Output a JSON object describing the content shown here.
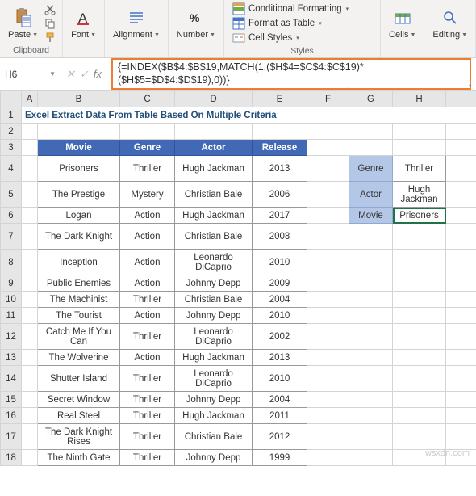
{
  "ribbon": {
    "clipboard": {
      "paste": "Paste",
      "label": "Clipboard"
    },
    "font": {
      "btn": "Font"
    },
    "alignment": {
      "btn": "Alignment"
    },
    "number": {
      "btn": "Number"
    },
    "styles": {
      "cond": "Conditional Formatting",
      "table": "Format as Table",
      "cell": "Cell Styles",
      "label": "Styles"
    },
    "cells": {
      "btn": "Cells"
    },
    "editing": {
      "btn": "Editing"
    }
  },
  "namebox": "H6",
  "fx": "fx",
  "formula": "{=INDEX($B$4:$B$19,MATCH(1,($H$4=$C$4:$C$19)*($H$5=$D$4:$D$19),0))}",
  "cols": [
    "A",
    "B",
    "C",
    "D",
    "E",
    "F",
    "G",
    "H"
  ],
  "title": "Excel Extract Data From Table Based On Multiple Criteria",
  "headers": {
    "movie": "Movie",
    "genre": "Genre",
    "actor": "Actor",
    "release": "Release"
  },
  "rows": [
    {
      "movie": "Prisoners",
      "genre": "Thriller",
      "actor": "Hugh Jackman",
      "release": "2013"
    },
    {
      "movie": "The Prestige",
      "genre": "Mystery",
      "actor": "Christian Bale",
      "release": "2006"
    },
    {
      "movie": "Logan",
      "genre": "Action",
      "actor": "Hugh Jackman",
      "release": "2017"
    },
    {
      "movie": "The Dark Knight",
      "genre": "Action",
      "actor": "Christian Bale",
      "release": "2008"
    },
    {
      "movie": "Inception",
      "genre": "Action",
      "actor": "Leonardo DiCaprio",
      "release": "2010"
    },
    {
      "movie": "Public Enemies",
      "genre": "Action",
      "actor": "Johnny Depp",
      "release": "2009"
    },
    {
      "movie": "The Machinist",
      "genre": "Thriller",
      "actor": "Christian Bale",
      "release": "2004"
    },
    {
      "movie": "The Tourist",
      "genre": "Action",
      "actor": "Johnny Depp",
      "release": "2010"
    },
    {
      "movie": "Catch Me If You Can",
      "genre": "Thriller",
      "actor": "Leonardo DiCaprio",
      "release": "2002"
    },
    {
      "movie": "The Wolverine",
      "genre": "Action",
      "actor": "Hugh Jackman",
      "release": "2013"
    },
    {
      "movie": "Shutter Island",
      "genre": "Thriller",
      "actor": "Leonardo DiCaprio",
      "release": "2010"
    },
    {
      "movie": "Secret Window",
      "genre": "Thriller",
      "actor": "Johnny Depp",
      "release": "2004"
    },
    {
      "movie": "Real Steel",
      "genre": "Thriller",
      "actor": "Hugh Jackman",
      "release": "2011"
    },
    {
      "movie": "The Dark Knight Rises",
      "genre": "Thriller",
      "actor": "Christian Bale",
      "release": "2012"
    },
    {
      "movie": "The Ninth Gate",
      "genre": "Thriller",
      "actor": "Johnny Depp",
      "release": "1999"
    }
  ],
  "side": {
    "genre_label": "Genre",
    "genre_val": "Thriller",
    "actor_label": "Actor",
    "actor_val": "Hugh Jackman",
    "movie_label": "Movie",
    "movie_val": "Prisoners"
  },
  "rownums": [
    "1",
    "2",
    "3",
    "4",
    "5",
    "6",
    "7",
    "8",
    "9",
    "10",
    "11",
    "12",
    "13",
    "14",
    "15",
    "16",
    "17",
    "18"
  ],
  "watermark": "wsxdn.com"
}
